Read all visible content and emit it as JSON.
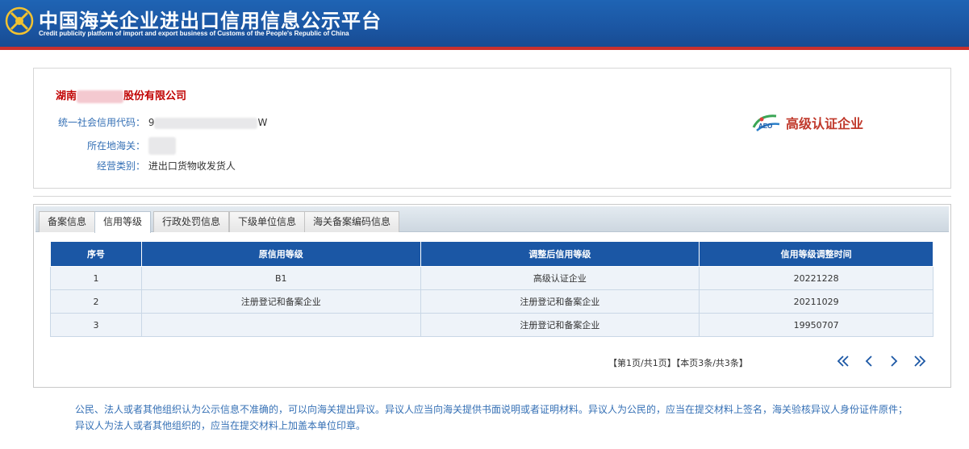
{
  "header": {
    "title_cn": "中国海关企业进出口信用信息公示平台",
    "title_en": "Credit publicity platform of import and export business of Customs of the People's Republic of China"
  },
  "company": {
    "name_prefix": "湖南",
    "name_suffix": "股份有限公司",
    "credit_code_label": "统一社会信用代码：",
    "credit_code_prefix": "9",
    "credit_code_suffix": "W",
    "customs_label": "所在地海关：",
    "business_type_label": "经营类别：",
    "business_type_value": "进出口货物收发货人",
    "badge_mark": "AEO",
    "badge_text": "高级认证企业"
  },
  "tabs": [
    {
      "label": "备案信息",
      "active": false
    },
    {
      "label": "信用等级",
      "active": true
    },
    {
      "label": "行政处罚信息",
      "active": false
    },
    {
      "label": "下级单位信息",
      "active": false
    },
    {
      "label": "海关备案编码信息",
      "active": false
    }
  ],
  "table": {
    "headers": [
      "序号",
      "原信用等级",
      "调整后信用等级",
      "信用等级调整时间"
    ],
    "rows": [
      [
        "1",
        "B1",
        "高级认证企业",
        "20221228"
      ],
      [
        "2",
        "注册登记和备案企业",
        "注册登记和备案企业",
        "20211029"
      ],
      [
        "3",
        "",
        "注册登记和备案企业",
        "19950707"
      ]
    ]
  },
  "pager": {
    "info": "【第1页/共1页】【本页3条/共3条】",
    "icons": [
      "first-page-icon",
      "prev-page-icon",
      "next-page-icon",
      "last-page-icon"
    ],
    "color": "#1b57a5"
  },
  "notice": "公民、法人或者其他组织认为公示信息不准确的，可以向海关提出异议。异议人应当向海关提供书面说明或者证明材料。异议人为公民的，应当在提交材料上签名，海关验核异议人身份证件原件；异议人为法人或者其他组织的，应当在提交材料上加盖本单位印章。",
  "colors": {
    "header_blue": "#1b56a3",
    "company_red": "#c00000",
    "label_blue": "#3570b5",
    "table_header": "#1b57a5"
  }
}
